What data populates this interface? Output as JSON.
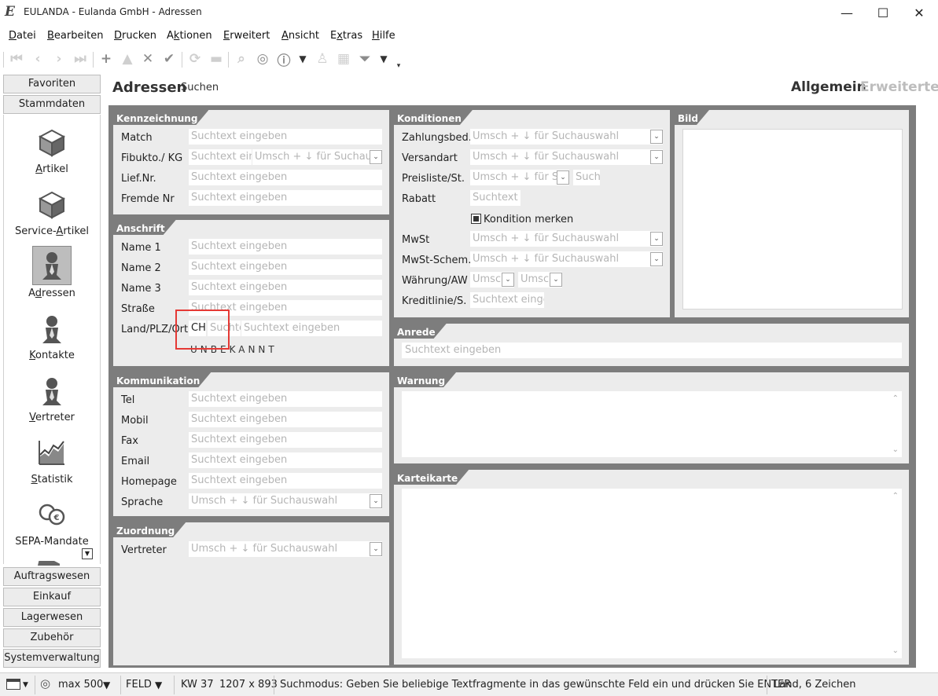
{
  "window": {
    "title": "EULANDA - Eulanda GmbH - Adressen",
    "minimize": "—",
    "maximize": "☐",
    "close": "✕"
  },
  "menu": [
    {
      "u": "D",
      "rest": "atei"
    },
    {
      "u": "B",
      "rest": "earbeiten"
    },
    {
      "u": "D",
      "rest": "rucken"
    },
    {
      "pre": "A",
      "u": "k",
      "rest": "tionen"
    },
    {
      "u": "E",
      "rest": "rweitert"
    },
    {
      "u": "A",
      "rest": "nsicht"
    },
    {
      "pre": "E",
      "u": "x",
      "rest": "tras"
    },
    {
      "u": "H",
      "rest": "ilfe"
    }
  ],
  "sidebar": {
    "favorites": "Favoriten",
    "master_data": "Stammdaten",
    "items": [
      {
        "name": "Artikel",
        "u": "A",
        "icon": "cube-icon"
      },
      {
        "name": "Service-Artikel",
        "u": "A",
        "icon": "cube-icon"
      },
      {
        "name": "Adressen",
        "u": "d",
        "icon": "person-icon",
        "active": true
      },
      {
        "name": "Kontakte",
        "u": "K",
        "icon": "person-icon"
      },
      {
        "name": "Vertreter",
        "u": "V",
        "icon": "person-icon"
      },
      {
        "name": "Statistik",
        "u": "S",
        "icon": "chart-icon"
      },
      {
        "name": "SEPA-Mandate",
        "u": "",
        "icon": "coins-icon"
      }
    ],
    "bottom": [
      "Auftragswesen",
      "Einkauf",
      "Lagerwesen",
      "Zubehör",
      "Systemverwaltung"
    ]
  },
  "page": {
    "title": "Adressen",
    "mode": "Suchen",
    "view_general": "Allgemein",
    "view_extended": "Erweiterte"
  },
  "placeholders": {
    "text": "Suchtext eingeben",
    "combo": "Umsch + ↓ für Suchauswahl"
  },
  "groups": {
    "kennzeichnung": {
      "title": "Kennzeichnung",
      "match": "Match",
      "fibukto": "Fibukto./ KG",
      "liefnr": "Lief.Nr.",
      "fremdenr": "Fremde Nr"
    },
    "anschrift": {
      "title": "Anschrift",
      "name1": "Name 1",
      "name2": "Name 2",
      "name3": "Name 3",
      "strasse": "Straße",
      "land_plz_ort": "Land/PLZ/Ort",
      "land_value": "CH",
      "plz_placeholder": "Suchte",
      "country_status": "UNBEKANNT"
    },
    "kommunikation": {
      "title": "Kommunikation",
      "tel": "Tel",
      "mobil": "Mobil",
      "fax": "Fax",
      "email": "Email",
      "homepage": "Homepage",
      "sprache": "Sprache"
    },
    "zuordnung": {
      "title": "Zuordnung",
      "vertreter": "Vertreter"
    },
    "konditionen": {
      "title": "Konditionen",
      "zahlungsbed": "Zahlungsbed.",
      "versandart": "Versandart",
      "preisliste": "Preisliste/St.",
      "preisliste_combo": "Umsch + ↓ für Su",
      "preisliste_text": "Such",
      "rabatt": "Rabatt",
      "rabatt_text": "Suchtext e",
      "kondition_merken": "Kondition merken",
      "mwst": "MwSt",
      "mwst_schema": "MwSt-Schem.",
      "waehrung": "Währung/AW",
      "waehrung_combo1": "Umsch",
      "waehrung_combo2": "Umsch",
      "kreditlinie": "Kreditlinie/S.",
      "kreditlinie_text": "Suchtext eingel"
    },
    "bild": {
      "title": "Bild"
    },
    "anrede": {
      "title": "Anrede"
    },
    "warnung": {
      "title": "Warnung"
    },
    "karteikarte": {
      "title": "Karteikarte"
    },
    "fibukto_text": "Suchtext ein",
    "fibukto_combo": "Umsch + ↓ für Suchaus"
  },
  "statusbar": {
    "max": "max 500",
    "feld": "FELD",
    "week": "KW 37",
    "resolution": "1207 x 893",
    "message": "Suchmodus: Geben Sie beliebige Textfragmente in das gewünschte Feld ein und drücken Sie ENTER",
    "field_info": "Land, 6 Zeichen"
  },
  "colors": {
    "panel_dark": "#7d7d7d",
    "panel_light": "#ececec",
    "highlight": "#e53935"
  }
}
